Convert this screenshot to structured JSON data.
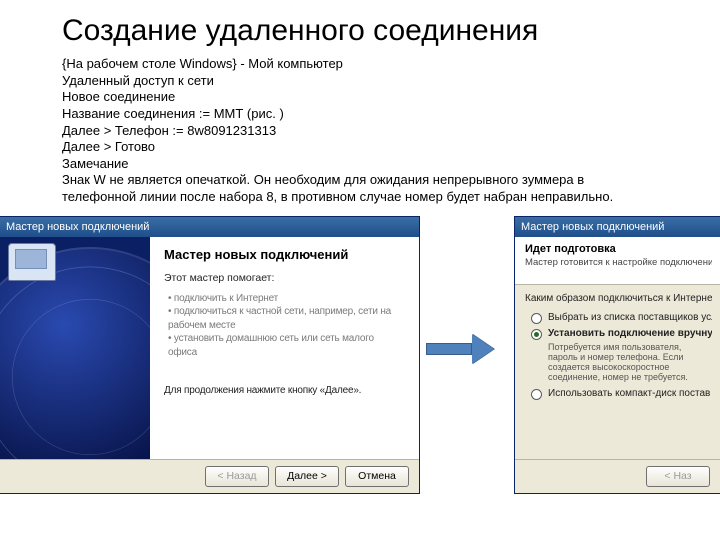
{
  "title": "Создание удаленного соединения",
  "body": {
    "l1": "{На рабочем столе Windows} - Мой компьютер",
    "l2": "Удаленный доступ к сети",
    "l3": "Новое соединение",
    "l4": "Название соединения := ММТ (рис. )",
    "l5": "Далее > Телефон := 8w8091231313",
    "l6": "Далее > Готово",
    "l7": "Замечание",
    "l8": "Знак W не является опечаткой. Он необходим для ожидания непрерывного зуммера в телефонной линии после набора 8, в противном случае номер будет набран неправильно."
  },
  "wiz1": {
    "title": "Мастер новых подключений",
    "heading": "Мастер новых подключений",
    "lead": "Этот мастер помогает:",
    "b1": "подключить к Интернет",
    "b2": "подключиться к частной сети, например, сети на рабочем месте",
    "b3": "установить домашнюю сеть или сеть малого офиса",
    "hint": "Для продолжения нажмите кнопку «Далее».",
    "back": "< Назад",
    "next": "Далее >",
    "cancel": "Отмена"
  },
  "wiz2": {
    "title": "Мастер новых подключений",
    "h1": "Идет подготовка",
    "h2": "Мастер готовится к настройке подключения к Ин",
    "q": "Каким образом подключиться к Интернету?",
    "r1": "Выбрать из списка поставщиков усл",
    "r2": "Установить подключение вручную",
    "r2desc": "Потребуется имя пользователя, пароль и номер телефона. Если создается высокоскоростное соединение, номер не требуется.",
    "r3": "Использовать компакт-диск постав",
    "back": "< Наз"
  }
}
